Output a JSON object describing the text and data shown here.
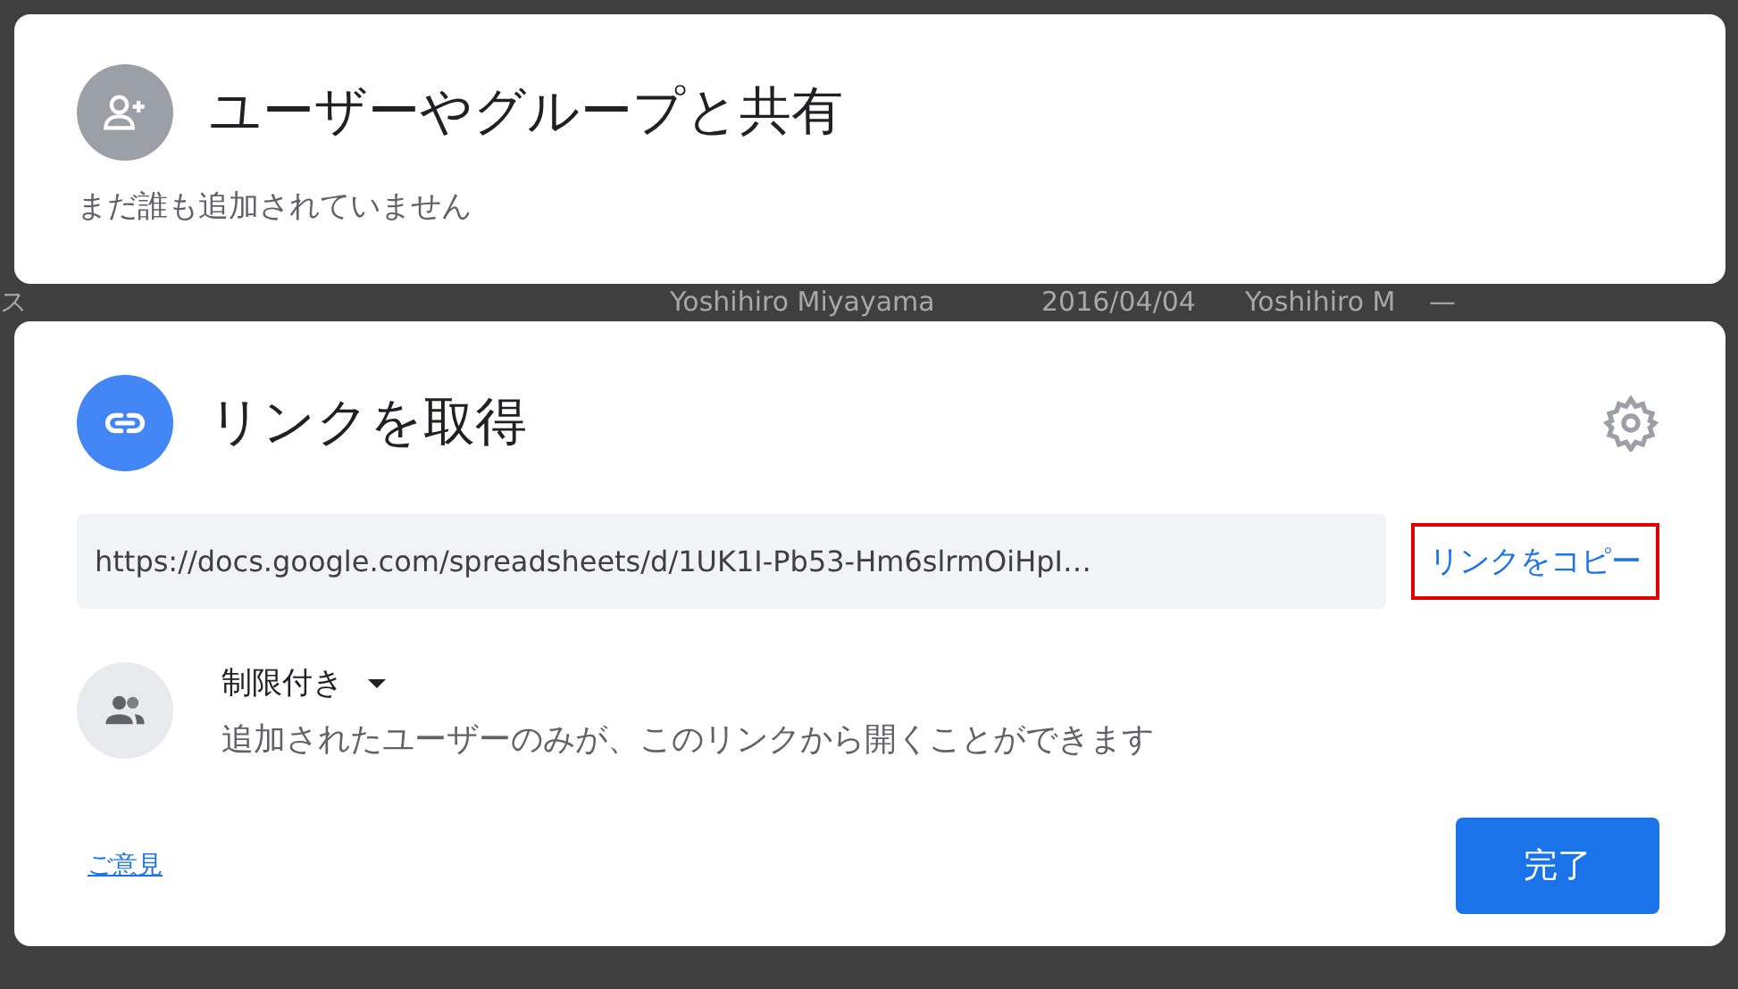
{
  "background_row": [
    "ス",
    "Yoshihiro Miyayama",
    "2016/04/04",
    "Yoshihiro M",
    "—"
  ],
  "share_card": {
    "title": "ユーザーやグループと共有",
    "empty_message": "まだ誰も追加されていません"
  },
  "link_card": {
    "title": "リンクを取得",
    "url": "https://docs.google.com/spreadsheets/d/1UK1I-Pb53-Hm6slrmOiHpI…",
    "copy_link": {
      "label": "リンクをコピー",
      "highlighted": true
    },
    "access": {
      "label": "制限付き",
      "description": "追加されたユーザーのみが、このリンクから開くことができます"
    },
    "feedback_link": "ご意見",
    "done_button": "完了"
  }
}
